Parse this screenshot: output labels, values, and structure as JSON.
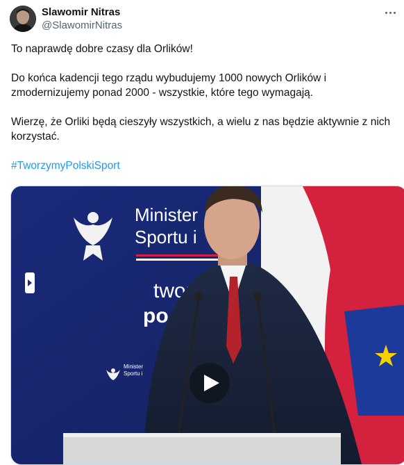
{
  "author": {
    "name": "Slawomir Nitras",
    "handle": "@SlawomirNitras"
  },
  "tweet": {
    "paragraphs": [
      "To naprawdę dobre czasy dla Orlików!",
      "Do końca kadencji tego rządu wybudujemy 1000 nowych Orlików i zmodernizujemy ponad 2000 - wszystkie, które tego wymagają.",
      "Wierzę, że Orliki będą cieszyły wszystkich, a wielu z nas będzie aktywnie z nich korzystać."
    ],
    "hashtag": "#TworzymyPolskiSport"
  },
  "video": {
    "backdrop_text": {
      "ministry_line1": "Minister",
      "ministry_line2": "Sportu i",
      "slogan_line1": "twor",
      "slogan_line2": "po",
      "small_line1": "Minister",
      "small_line2": "Sportu i"
    },
    "play_icon": "play-icon"
  },
  "colors": {
    "hashtag": "#1d9bf0",
    "handle": "#536471",
    "backdrop": "#1e2d78",
    "flag_red": "#d4213d"
  }
}
